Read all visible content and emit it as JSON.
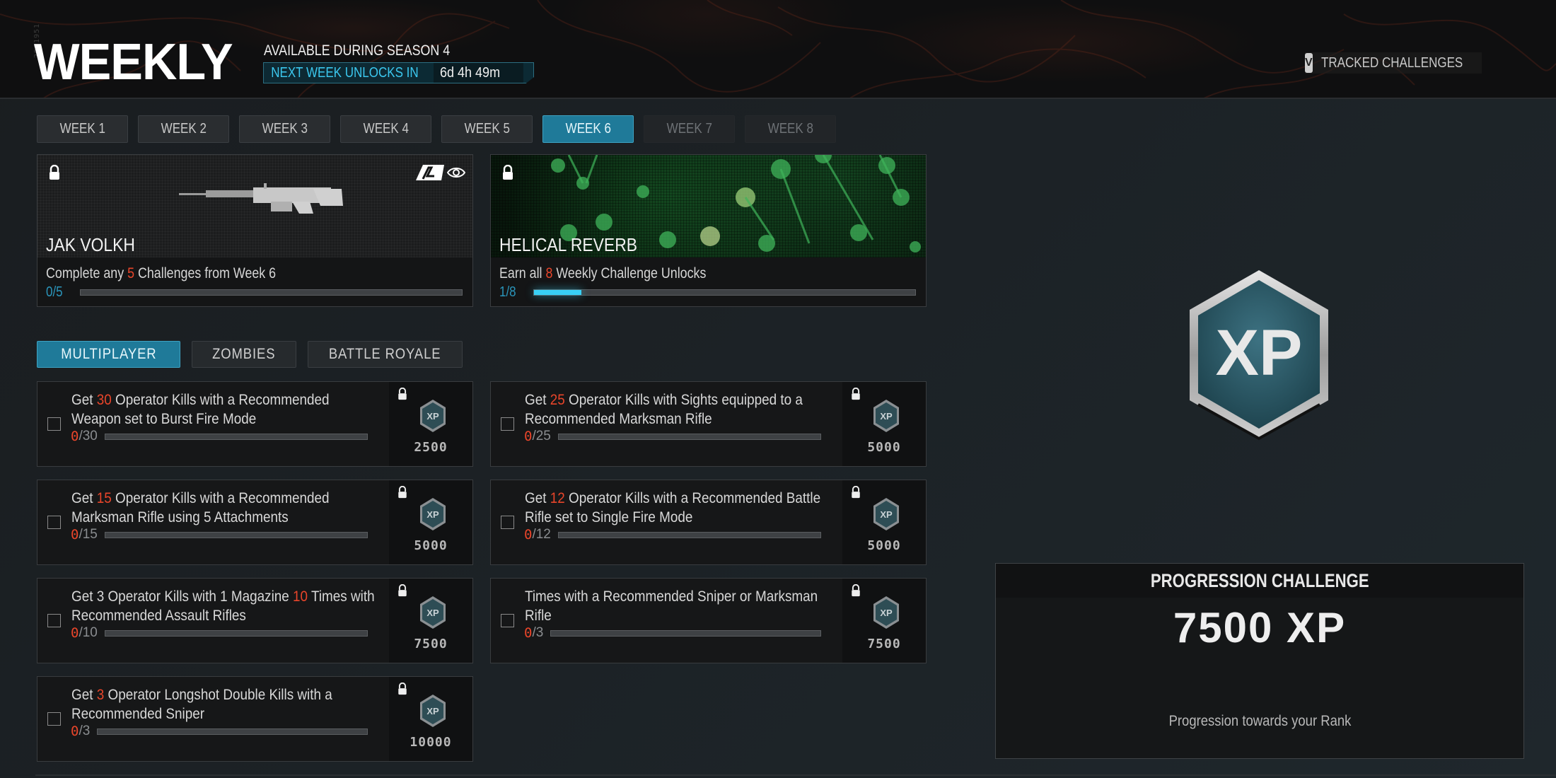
{
  "header": {
    "side_id": "2901951",
    "title": "WEEKLY",
    "season_label": "AVAILABLE DURING SEASON 4",
    "next_unlock_label": "NEXT WEEK UNLOCKS IN",
    "next_unlock_time": "6d 4h 49m",
    "tracked": {
      "key": "V",
      "label": "TRACKED CHALLENGES"
    }
  },
  "weeks": [
    {
      "label": "WEEK 1",
      "state": "normal"
    },
    {
      "label": "WEEK 2",
      "state": "normal"
    },
    {
      "label": "WEEK 3",
      "state": "normal"
    },
    {
      "label": "WEEK 4",
      "state": "normal"
    },
    {
      "label": "WEEK 5",
      "state": "normal"
    },
    {
      "label": "WEEK 6",
      "state": "active"
    },
    {
      "label": "WEEK 7",
      "state": "locked"
    },
    {
      "label": "WEEK 8",
      "state": "locked"
    }
  ],
  "rewards": [
    {
      "name": "JAK VOLKH",
      "desc_pre": "Complete any ",
      "desc_num": "5",
      "desc_post": " Challenges from Week 6",
      "progress_text": "0/5",
      "progress": 0.0,
      "icons": [
        "lock-icon",
        "brand-icon",
        "eye-icon"
      ]
    },
    {
      "name": "HELICAL REVERB",
      "desc_pre": "Earn all ",
      "desc_num": "8",
      "desc_post": " Weekly Challenge Unlocks",
      "progress_text": "1/8",
      "progress": 0.125,
      "icons": [
        "lock-icon"
      ]
    }
  ],
  "modes": [
    {
      "label": "MULTIPLAYER",
      "active": true
    },
    {
      "label": "ZOMBIES",
      "active": false
    },
    {
      "label": "BATTLE ROYALE",
      "active": false
    }
  ],
  "challenges": [
    {
      "pre": "Get ",
      "num": "30",
      "post": " Operator Kills with a Recommended Weapon set to Burst Fire Mode",
      "current": "0",
      "total": "/30",
      "progress": 0,
      "xp": "2500"
    },
    {
      "pre": "Get ",
      "num": "25",
      "post": " Operator Kills with Sights equipped to a Recommended Marksman Rifle",
      "current": "0",
      "total": "/25",
      "progress": 0,
      "xp": "5000"
    },
    {
      "pre": "Get ",
      "num": "15",
      "post": " Operator Kills with a Recommended Marksman Rifle using 5 Attachments",
      "current": "0",
      "total": "/15",
      "progress": 0,
      "xp": "5000"
    },
    {
      "pre": "Get ",
      "num": "12",
      "post": " Operator Kills with a Recommended Battle Rifle set to Single Fire Mode",
      "current": "0",
      "total": "/12",
      "progress": 0,
      "xp": "5000"
    },
    {
      "pre": "Get 3 Operator Kills with 1 Magazine ",
      "num": "10",
      "post": " Times with Recommended Assault Rifles",
      "current": "0",
      "total": "/10",
      "progress": 0,
      "xp": "7500"
    },
    {
      "pre": "Times with a Recommended Sniper or Marksman Rifle",
      "num": "",
      "post": "",
      "current": "0",
      "total": "/3",
      "progress": 0,
      "xp": "7500"
    },
    {
      "pre": "Get ",
      "num": "3",
      "post": " Operator Longshot Double Kills with a Recommended Sniper",
      "current": "0",
      "total": "/3",
      "progress": 0,
      "xp": "10000"
    }
  ],
  "progression": {
    "title": "PROGRESSION CHALLENGE",
    "xp": "7500 XP",
    "desc": "Progression towards your Rank",
    "badge_text": "XP"
  },
  "colors": {
    "accent": "#1f7a99",
    "accent_text": "#3bc7ee",
    "highlight": "#e8452a",
    "progress_fill": "#38d0f5"
  }
}
